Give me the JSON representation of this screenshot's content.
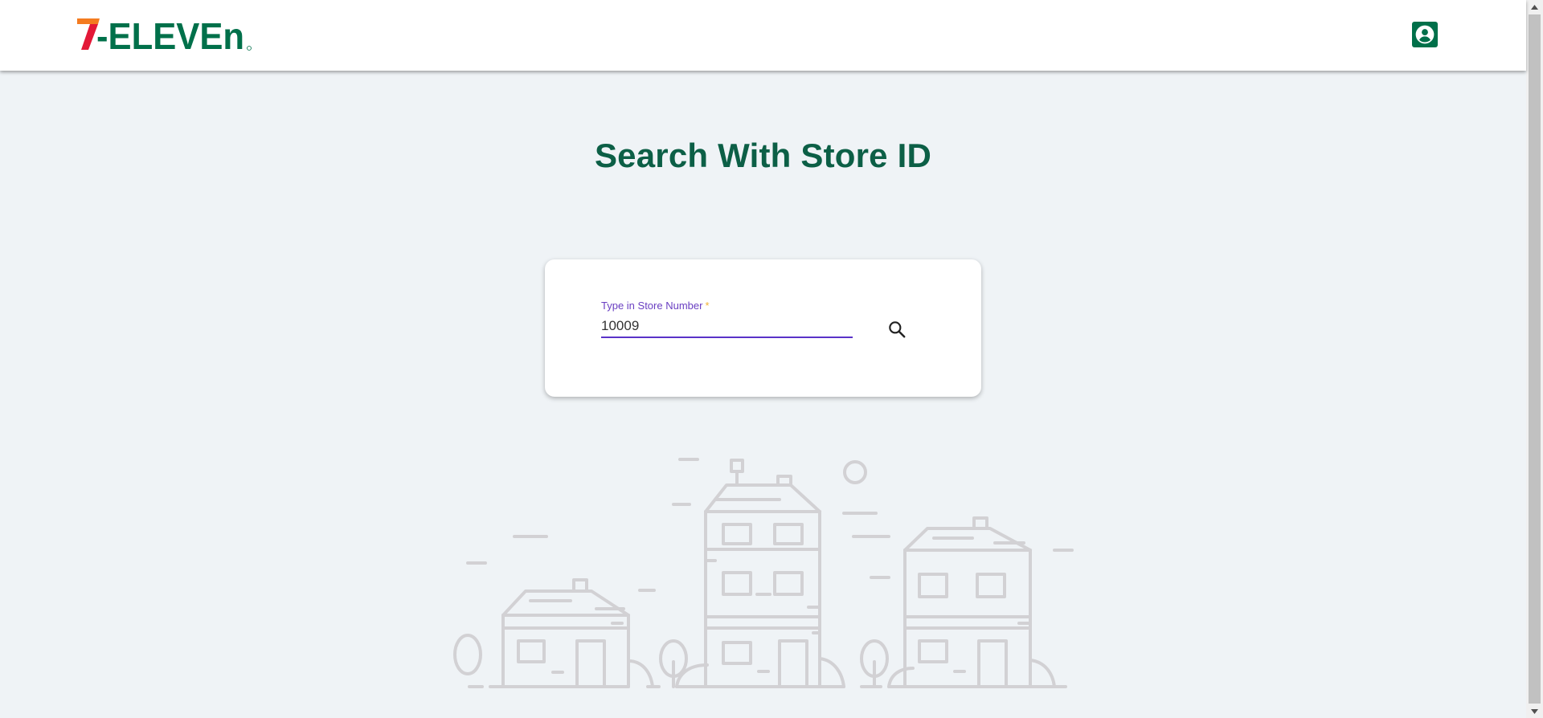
{
  "header": {
    "logo_text": "7-ELEVEN",
    "account_icon": "account-circle-icon"
  },
  "main": {
    "title": "Search With Store ID",
    "search": {
      "label": "Type in Store Number",
      "required_marker": "*",
      "value": "10009",
      "button_icon": "search-icon"
    },
    "illustration": "houses-illustration"
  },
  "colors": {
    "brand_green": "#0c5f46",
    "button_green": "#00704a",
    "accent_purple": "#5a33c8",
    "background": "#eff3f6",
    "logo_orange": "#f47b20",
    "logo_red": "#e31837"
  }
}
